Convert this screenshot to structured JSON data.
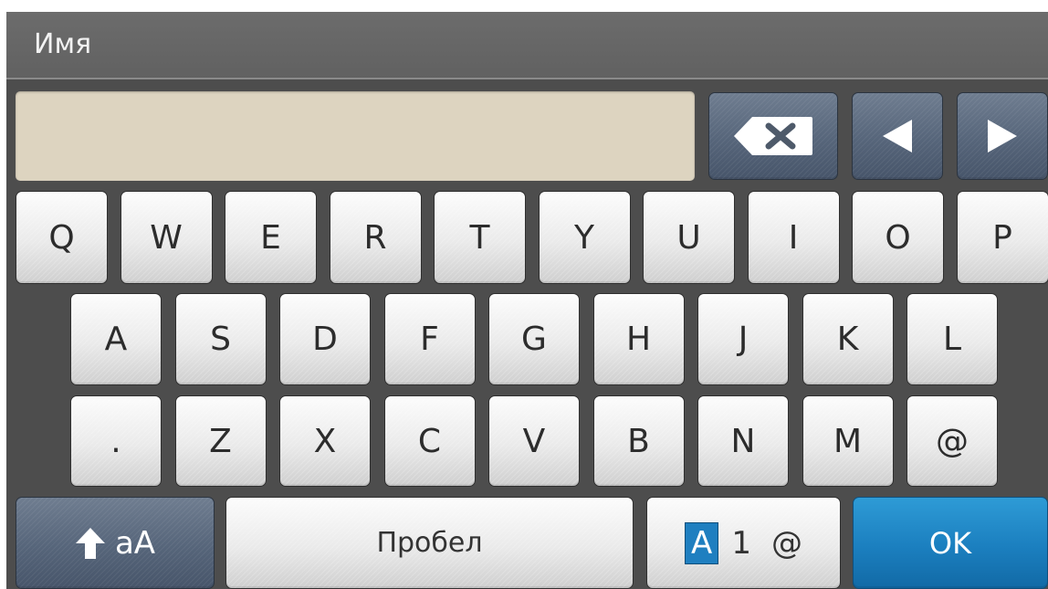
{
  "title_bar": {
    "title": "Имя"
  },
  "input": {
    "value": ""
  },
  "keyboard": {
    "row1": [
      "Q",
      "W",
      "E",
      "R",
      "T",
      "Y",
      "U",
      "I",
      "O",
      "P"
    ],
    "row2": [
      "A",
      "S",
      "D",
      "F",
      "G",
      "H",
      "J",
      "K",
      "L"
    ],
    "row3": [
      ".",
      "Z",
      "X",
      "C",
      "V",
      "B",
      "N",
      "M",
      "@"
    ]
  },
  "bottom": {
    "shift_label": "aA",
    "space_label": "Пробел",
    "mode": {
      "alpha": "A",
      "num": "1",
      "sym": "@"
    },
    "ok_label": "OK"
  },
  "icons": {
    "backspace": "backspace-icon",
    "left": "arrow-left-icon",
    "right": "arrow-right-icon",
    "shift": "shift-up-arrow-icon"
  },
  "colors": {
    "accent": "#1b7fbf",
    "input_bg": "#ddd4c0",
    "screen_bg": "#4d4d4d",
    "nav_key": "#56657a"
  }
}
